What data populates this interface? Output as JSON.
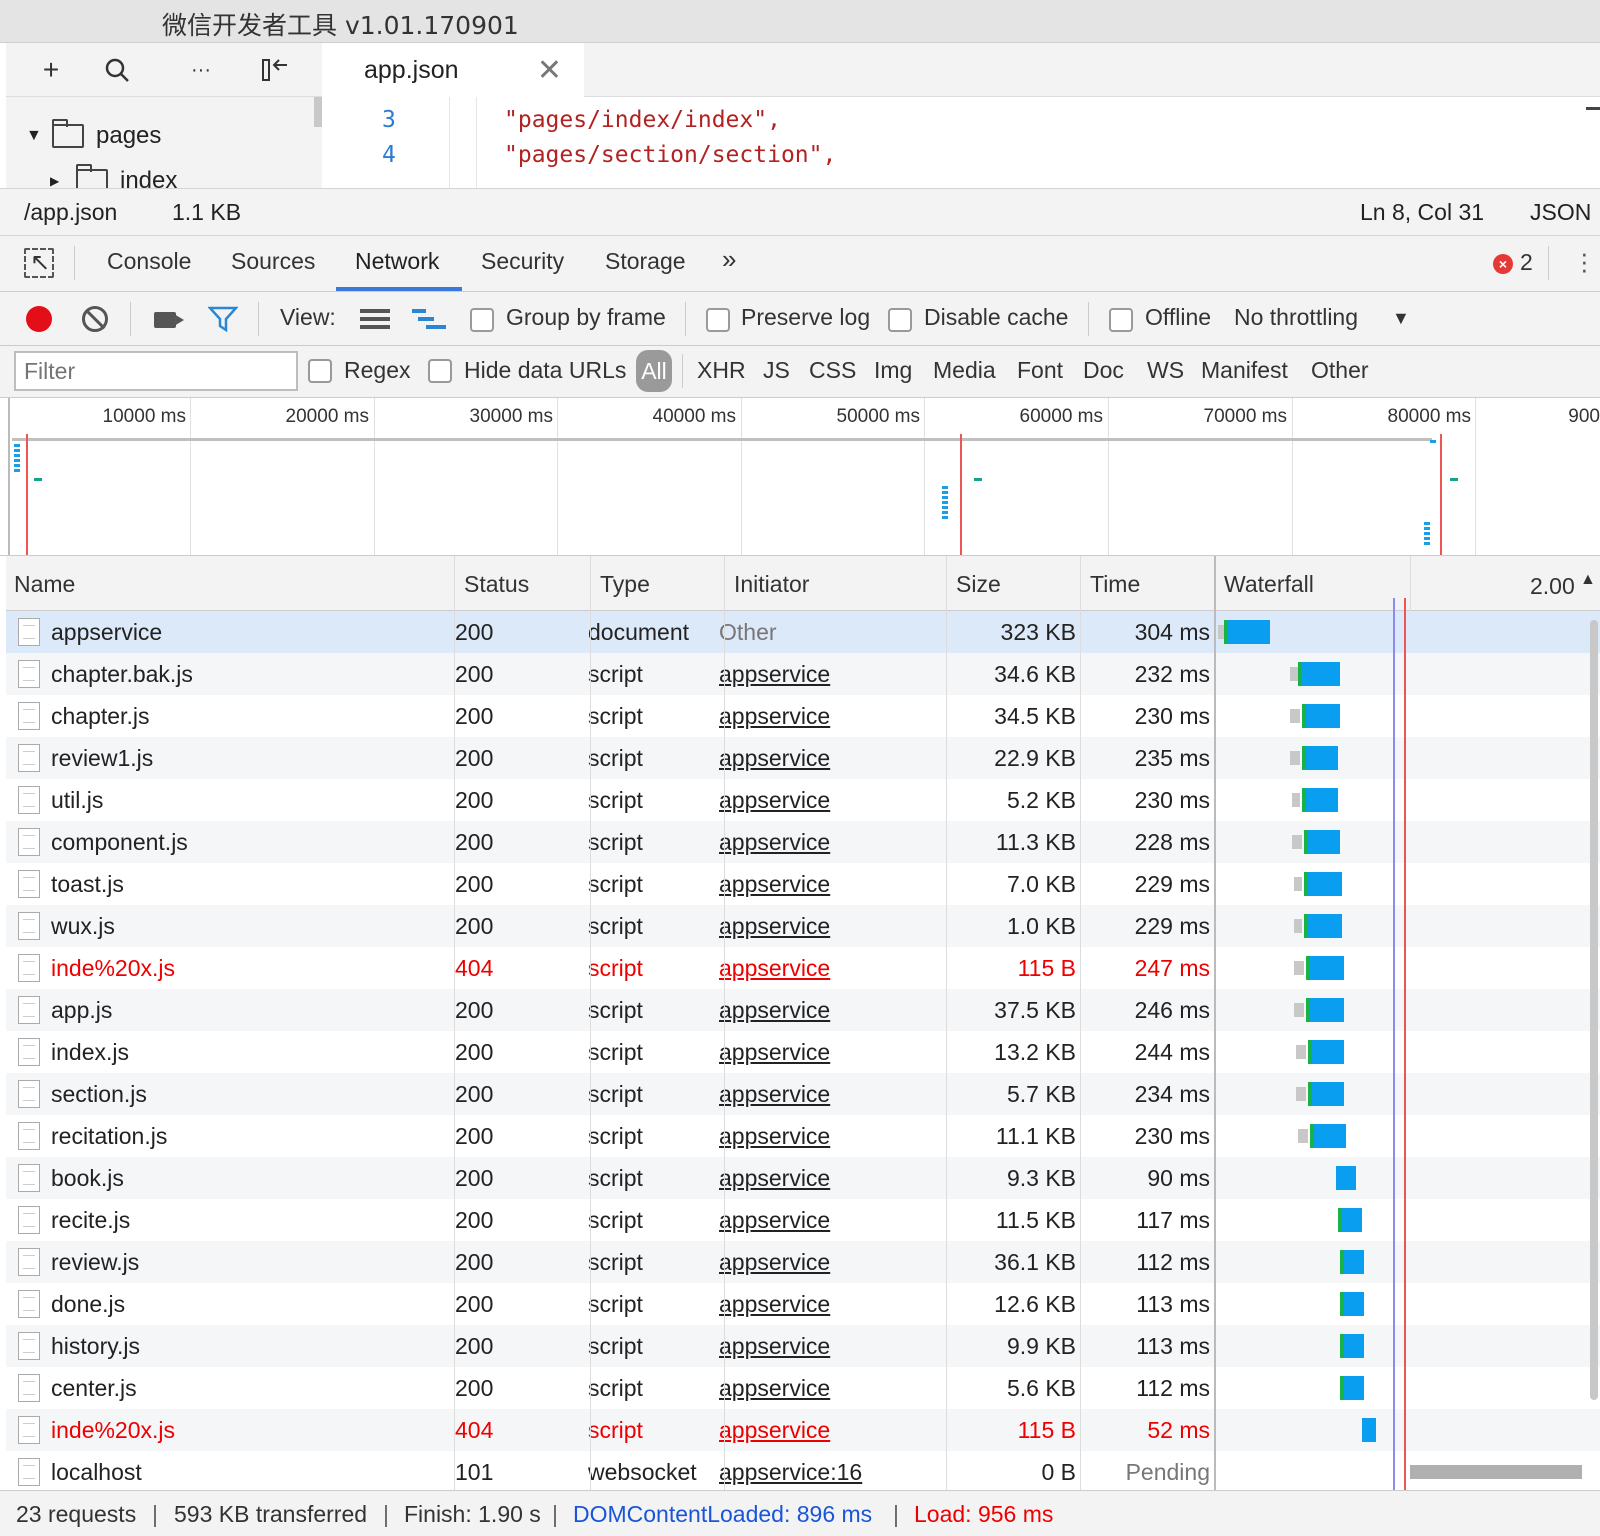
{
  "window": {
    "title": "微信开发者工具 v1.01.170901"
  },
  "editor": {
    "toolbar": {
      "add_icon": "+",
      "more_icon": "···"
    },
    "tree": {
      "folder_label": "pages",
      "sub_label": "index"
    },
    "tab": {
      "label": "app.json",
      "close": "✕"
    },
    "lines": [
      {
        "num": "3",
        "text": "\"pages/index/index\","
      },
      {
        "num": "4",
        "text": "\"pages/section/section\","
      }
    ]
  },
  "statusbar": {
    "path": "/app.json",
    "size": "1.1 KB",
    "position": "Ln 8, Col 31",
    "lang": "JSON"
  },
  "devtools": {
    "tabs": [
      "Console",
      "Sources",
      "Network",
      "Security",
      "Storage"
    ],
    "active_tab": "Network",
    "more": "»",
    "error_count": "2"
  },
  "network_toolbar": {
    "view_label": "View:",
    "group_by_frame": "Group by frame",
    "preserve_log": "Preserve log",
    "disable_cache": "Disable cache",
    "offline": "Offline",
    "throttling": "No throttling"
  },
  "filter": {
    "placeholder": "Filter",
    "regex": "Regex",
    "hide_data_urls": "Hide data URLs",
    "all": "All",
    "types": [
      "XHR",
      "JS",
      "CSS",
      "Img",
      "Media",
      "Font",
      "Doc",
      "WS",
      "Manifest",
      "Other"
    ]
  },
  "overview": {
    "ticks": [
      "10000 ms",
      "20000 ms",
      "30000 ms",
      "40000 ms",
      "50000 ms",
      "60000 ms",
      "70000 ms",
      "80000 ms",
      "900"
    ]
  },
  "table": {
    "headers": {
      "name": "Name",
      "status": "Status",
      "type": "Type",
      "initiator": "Initiator",
      "size": "Size",
      "time": "Time",
      "waterfall": "Waterfall",
      "scale": "2.00"
    },
    "rows": [
      {
        "name": "appservice",
        "status": "200",
        "type": "document",
        "initiator": "Other",
        "size": "323 KB",
        "time": "304 ms"
      },
      {
        "name": "chapter.bak.js",
        "status": "200",
        "type": "script",
        "initiator": "appservice",
        "size": "34.6 KB",
        "time": "232 ms"
      },
      {
        "name": "chapter.js",
        "status": "200",
        "type": "script",
        "initiator": "appservice",
        "size": "34.5 KB",
        "time": "230 ms"
      },
      {
        "name": "review1.js",
        "status": "200",
        "type": "script",
        "initiator": "appservice",
        "size": "22.9 KB",
        "time": "235 ms"
      },
      {
        "name": "util.js",
        "status": "200",
        "type": "script",
        "initiator": "appservice",
        "size": "5.2 KB",
        "time": "230 ms"
      },
      {
        "name": "component.js",
        "status": "200",
        "type": "script",
        "initiator": "appservice",
        "size": "11.3 KB",
        "time": "228 ms"
      },
      {
        "name": "toast.js",
        "status": "200",
        "type": "script",
        "initiator": "appservice",
        "size": "7.0 KB",
        "time": "229 ms"
      },
      {
        "name": "wux.js",
        "status": "200",
        "type": "script",
        "initiator": "appservice",
        "size": "1.0 KB",
        "time": "229 ms"
      },
      {
        "name": "inde%20x.js",
        "status": "404",
        "type": "script",
        "initiator": "appservice",
        "size": "115 B",
        "time": "247 ms"
      },
      {
        "name": "app.js",
        "status": "200",
        "type": "script",
        "initiator": "appservice",
        "size": "37.5 KB",
        "time": "246 ms"
      },
      {
        "name": "index.js",
        "status": "200",
        "type": "script",
        "initiator": "appservice",
        "size": "13.2 KB",
        "time": "244 ms"
      },
      {
        "name": "section.js",
        "status": "200",
        "type": "script",
        "initiator": "appservice",
        "size": "5.7 KB",
        "time": "234 ms"
      },
      {
        "name": "recitation.js",
        "status": "200",
        "type": "script",
        "initiator": "appservice",
        "size": "11.1 KB",
        "time": "230 ms"
      },
      {
        "name": "book.js",
        "status": "200",
        "type": "script",
        "initiator": "appservice",
        "size": "9.3 KB",
        "time": "90 ms"
      },
      {
        "name": "recite.js",
        "status": "200",
        "type": "script",
        "initiator": "appservice",
        "size": "11.5 KB",
        "time": "117 ms"
      },
      {
        "name": "review.js",
        "status": "200",
        "type": "script",
        "initiator": "appservice",
        "size": "36.1 KB",
        "time": "112 ms"
      },
      {
        "name": "done.js",
        "status": "200",
        "type": "script",
        "initiator": "appservice",
        "size": "12.6 KB",
        "time": "113 ms"
      },
      {
        "name": "history.js",
        "status": "200",
        "type": "script",
        "initiator": "appservice",
        "size": "9.9 KB",
        "time": "113 ms"
      },
      {
        "name": "center.js",
        "status": "200",
        "type": "script",
        "initiator": "appservice",
        "size": "5.6 KB",
        "time": "112 ms"
      },
      {
        "name": "inde%20x.js",
        "status": "404",
        "type": "script",
        "initiator": "appservice",
        "size": "115 B",
        "time": "52 ms"
      },
      {
        "name": "localhost",
        "status": "101",
        "type": "websocket",
        "initiator": "appservice:16",
        "size": "0 B",
        "time": "Pending"
      }
    ]
  },
  "summary": {
    "requests": "23 requests",
    "transferred": "593 KB transferred",
    "finish": "Finish: 1.90 s",
    "dom": "DOMContentLoaded: 896 ms",
    "load": "Load: 956 ms",
    "sep": "|"
  }
}
